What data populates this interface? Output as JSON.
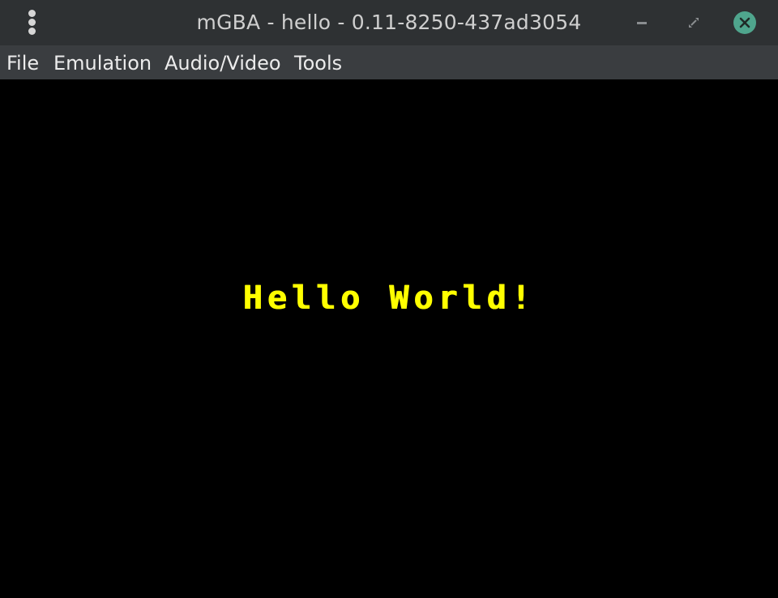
{
  "window": {
    "title": "mGBA - hello - 0.11-8250-437ad3054",
    "buttons": {
      "menu_icon": "kebab-menu-icon",
      "minimize_icon": "minimize-icon",
      "maximize_icon": "maximize-icon",
      "close_icon": "close-icon",
      "close_color": "#4fa58d"
    }
  },
  "menubar": {
    "items": [
      {
        "label": "File"
      },
      {
        "label": "Emulation"
      },
      {
        "label": "Audio/Video"
      },
      {
        "label": "Tools"
      }
    ]
  },
  "game_screen": {
    "text": "Hello World!",
    "text_color": "#ffff00",
    "background": "#000000"
  }
}
